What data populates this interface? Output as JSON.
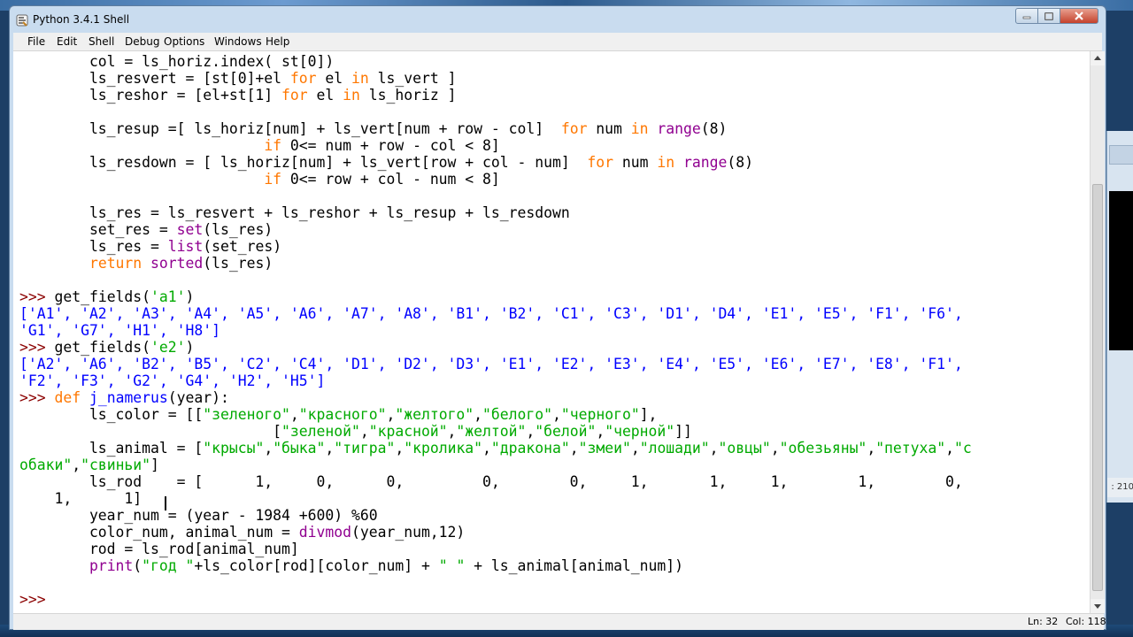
{
  "window": {
    "title": "Python 3.4.1 Shell",
    "accent_title_bg": "#c9dcef",
    "close_button_color": "#c4412c"
  },
  "menu": {
    "items": [
      "File",
      "Edit",
      "Shell",
      "Debug",
      "Options",
      "Windows",
      "Help"
    ]
  },
  "editor": {
    "colors": {
      "keyword": "#ff7700",
      "builtin": "#900090",
      "string": "#00aa00",
      "output": "#0000ff",
      "definition": "#0000ff"
    },
    "lines": [
      [
        {
          "t": "        col = ls_horiz.index( st[0])"
        }
      ],
      [
        {
          "t": "        ls_resvert = [st[0]+el "
        },
        {
          "t": "for",
          "c": "kw"
        },
        {
          "t": " el "
        },
        {
          "t": "in",
          "c": "kw"
        },
        {
          "t": " ls_vert ]"
        }
      ],
      [
        {
          "t": "        ls_reshor = [el+st[1] "
        },
        {
          "t": "for",
          "c": "kw"
        },
        {
          "t": " el "
        },
        {
          "t": "in",
          "c": "kw"
        },
        {
          "t": " ls_horiz ]"
        }
      ],
      [
        {
          "t": ""
        }
      ],
      [
        {
          "t": "        ls_resup =[ ls_horiz[num] + ls_vert[num + row - col]  "
        },
        {
          "t": "for",
          "c": "kw"
        },
        {
          "t": " num "
        },
        {
          "t": "in",
          "c": "kw"
        },
        {
          "t": " "
        },
        {
          "t": "range",
          "c": "bi"
        },
        {
          "t": "(8)"
        }
      ],
      [
        {
          "t": "                            "
        },
        {
          "t": "if",
          "c": "kw"
        },
        {
          "t": " 0<= num + row - col < 8]"
        }
      ],
      [
        {
          "t": "        ls_resdown = [ ls_horiz[num] + ls_vert[row + col - num]  "
        },
        {
          "t": "for",
          "c": "kw"
        },
        {
          "t": " num "
        },
        {
          "t": "in",
          "c": "kw"
        },
        {
          "t": " "
        },
        {
          "t": "range",
          "c": "bi"
        },
        {
          "t": "(8)"
        }
      ],
      [
        {
          "t": "                            "
        },
        {
          "t": "if",
          "c": "kw"
        },
        {
          "t": " 0<= row + col - num < 8]"
        }
      ],
      [
        {
          "t": ""
        }
      ],
      [
        {
          "t": "        ls_res = ls_resvert + ls_reshor + ls_resup + ls_resdown"
        }
      ],
      [
        {
          "t": "        set_res = "
        },
        {
          "t": "set",
          "c": "bi"
        },
        {
          "t": "(ls_res)"
        }
      ],
      [
        {
          "t": "        ls_res = "
        },
        {
          "t": "list",
          "c": "bi"
        },
        {
          "t": "(set_res)"
        }
      ],
      [
        {
          "t": "        "
        },
        {
          "t": "return",
          "c": "kw"
        },
        {
          "t": " "
        },
        {
          "t": "sorted",
          "c": "bi"
        },
        {
          "t": "(ls_res)"
        }
      ],
      [
        {
          "t": ""
        }
      ],
      [
        {
          "t": ">>> ",
          "c": "pr"
        },
        {
          "t": "get_fields("
        },
        {
          "t": "'a1'",
          "c": "st"
        },
        {
          "t": ")"
        }
      ],
      [
        {
          "t": "['A1', 'A2', 'A3', 'A4', 'A5', 'A6', 'A7', 'A8', 'B1', 'B2', 'C1', 'C3', 'D1', 'D4', 'E1', 'E5', 'F1', 'F6',",
          "c": "ot"
        }
      ],
      [
        {
          "t": "'G1', 'G7', 'H1', 'H8']",
          "c": "ot"
        }
      ],
      [
        {
          "t": ">>> ",
          "c": "pr"
        },
        {
          "t": "get_fields("
        },
        {
          "t": "'e2'",
          "c": "st"
        },
        {
          "t": ")"
        }
      ],
      [
        {
          "t": "['A2', 'A6', 'B2', 'B5', 'C2', 'C4', 'D1', 'D2', 'D3', 'E1', 'E2', 'E3', 'E4', 'E5', 'E6', 'E7', 'E8', 'F1',",
          "c": "ot"
        }
      ],
      [
        {
          "t": "'F2', 'F3', 'G2', 'G4', 'H2', 'H5']",
          "c": "ot"
        }
      ],
      [
        {
          "t": ">>> ",
          "c": "pr"
        },
        {
          "t": "def",
          "c": "kw"
        },
        {
          "t": " "
        },
        {
          "t": "j_namerus",
          "c": "ot"
        },
        {
          "t": "(year):"
        }
      ],
      [
        {
          "t": "        ls_color = [["
        },
        {
          "t": "\"зеленого\"",
          "c": "st"
        },
        {
          "t": ","
        },
        {
          "t": "\"красного\"",
          "c": "st"
        },
        {
          "t": ","
        },
        {
          "t": "\"желтого\"",
          "c": "st"
        },
        {
          "t": ","
        },
        {
          "t": "\"белого\"",
          "c": "st"
        },
        {
          "t": ","
        },
        {
          "t": "\"черного\"",
          "c": "st"
        },
        {
          "t": "],"
        }
      ],
      [
        {
          "t": "                             ["
        },
        {
          "t": "\"зеленой\"",
          "c": "st"
        },
        {
          "t": ","
        },
        {
          "t": "\"красной\"",
          "c": "st"
        },
        {
          "t": ","
        },
        {
          "t": "\"желтой\"",
          "c": "st"
        },
        {
          "t": ","
        },
        {
          "t": "\"белой\"",
          "c": "st"
        },
        {
          "t": ","
        },
        {
          "t": "\"черной\"",
          "c": "st"
        },
        {
          "t": "]]"
        }
      ],
      [
        {
          "t": "        ls_animal = ["
        },
        {
          "t": "\"крысы\"",
          "c": "st"
        },
        {
          "t": ","
        },
        {
          "t": "\"быка\"",
          "c": "st"
        },
        {
          "t": ","
        },
        {
          "t": "\"тигра\"",
          "c": "st"
        },
        {
          "t": ","
        },
        {
          "t": "\"кролика\"",
          "c": "st"
        },
        {
          "t": ","
        },
        {
          "t": "\"дракона\"",
          "c": "st"
        },
        {
          "t": ","
        },
        {
          "t": "\"змеи\"",
          "c": "st"
        },
        {
          "t": ","
        },
        {
          "t": "\"лошади\"",
          "c": "st"
        },
        {
          "t": ","
        },
        {
          "t": "\"овцы\"",
          "c": "st"
        },
        {
          "t": ","
        },
        {
          "t": "\"обезьяны\"",
          "c": "st"
        },
        {
          "t": ","
        },
        {
          "t": "\"петуха\"",
          "c": "st"
        },
        {
          "t": ","
        },
        {
          "t": "\"с",
          "c": "st"
        }
      ],
      [
        {
          "t": "обаки\"",
          "c": "st"
        },
        {
          "t": ","
        },
        {
          "t": "\"свиньи\"",
          "c": "st"
        },
        {
          "t": "]"
        }
      ],
      [
        {
          "t": "        ls_rod    = [      1,     0,      0,         0,        0,     1,       1,     1,        1,        0,"
        }
      ],
      [
        {
          "t": "    1,      1]"
        }
      ],
      [
        {
          "t": "        year_num = (year - 1984 +600) %60"
        }
      ],
      [
        {
          "t": "        color_num, animal_num = "
        },
        {
          "t": "divmod",
          "c": "bi"
        },
        {
          "t": "(year_num,12)"
        }
      ],
      [
        {
          "t": "        rod = ls_rod[animal_num]"
        }
      ],
      [
        {
          "t": "        "
        },
        {
          "t": "print",
          "c": "bi"
        },
        {
          "t": "("
        },
        {
          "t": "\"год \"",
          "c": "st"
        },
        {
          "t": "+ls_color[rod][color_num] + "
        },
        {
          "t": "\" \"",
          "c": "st"
        },
        {
          "t": " + ls_animal[animal_num])"
        }
      ],
      [
        {
          "t": ""
        }
      ],
      [
        {
          "t": ">>> ",
          "c": "pr"
        }
      ]
    ]
  },
  "status": {
    "ln": "Ln: 32",
    "col": "Col: 118"
  },
  "background_window": {
    "status_fragment": ": 210"
  }
}
